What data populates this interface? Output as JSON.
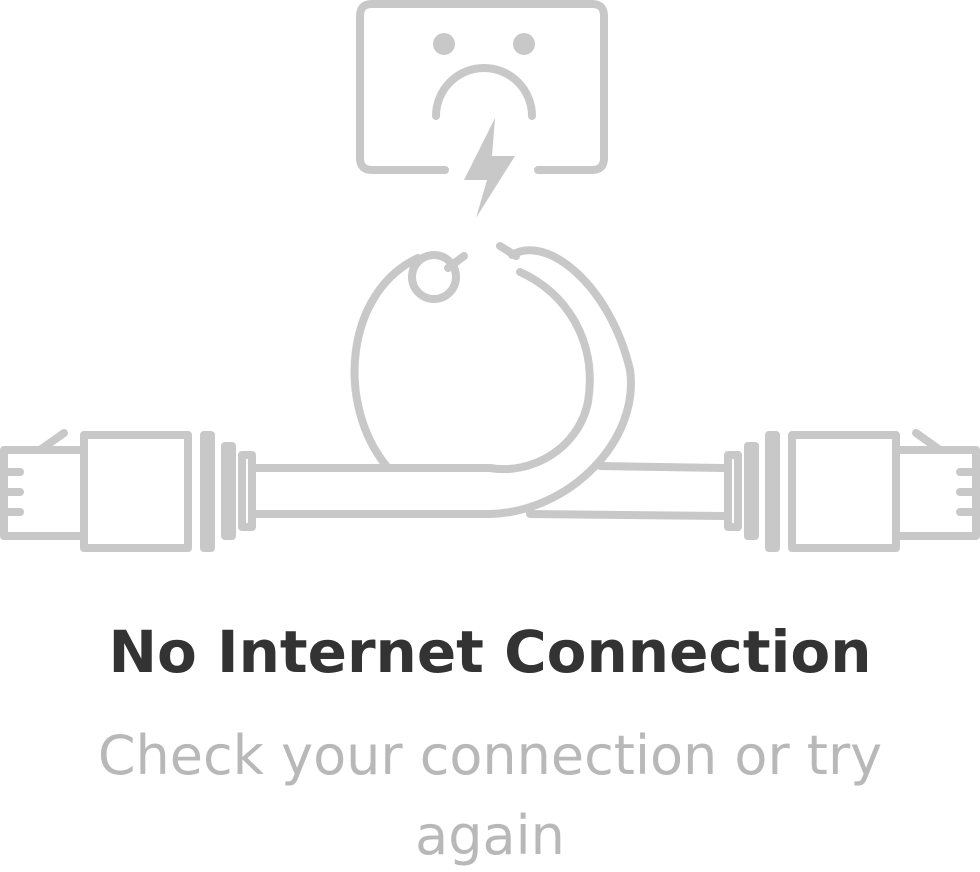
{
  "empty_state": {
    "illustration_icon": "disconnected-cable-sad-outlet-icon",
    "title": "No Internet Connection",
    "message": "Check your connection or try again"
  },
  "colors": {
    "illustration_stroke": "#c8c8c8",
    "title": "#333333",
    "message": "#b8b8b8",
    "background": "#ffffff"
  }
}
